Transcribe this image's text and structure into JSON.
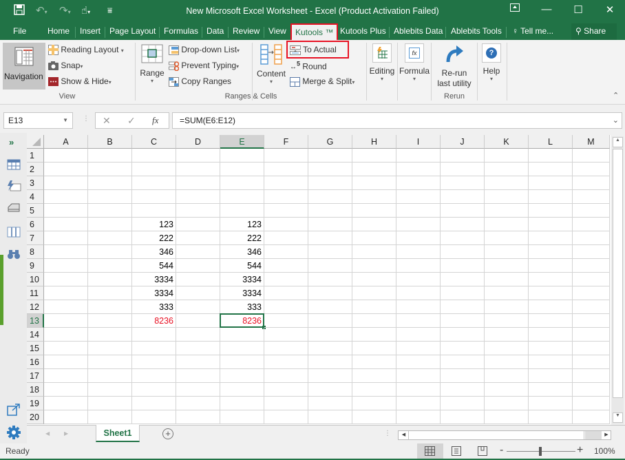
{
  "window": {
    "title": "New Microsoft Excel Worksheet - Excel (Product Activation Failed)",
    "controls": {
      "ribbon_display": "⊼",
      "minimize": "—",
      "maximize": "☐",
      "close": "✕"
    }
  },
  "quick_access": {
    "save": "save-icon",
    "undo": "undo-icon",
    "redo": "redo-icon",
    "touch": "touch-mode-icon",
    "customize": "customize-icon"
  },
  "ribbon_tabs": {
    "file": "File",
    "items": [
      "Home",
      "Insert",
      "Page Layout",
      "Formulas",
      "Data",
      "Review",
      "View",
      "Kutools ™",
      "Kutools Plus",
      "Ablebits Data",
      "Ablebits Tools"
    ],
    "active": "Kutools ™",
    "tell_me": "Tell me...",
    "share": "Share"
  },
  "ribbon": {
    "view_group": {
      "label": "View",
      "navigation": "Navigation",
      "reading_layout": "Reading Layout",
      "snap": "Snap",
      "show_hide": "Show & Hide"
    },
    "ranges_group": {
      "label": "Ranges & Cells",
      "range": "Range",
      "dropdown_list": "Drop-down List",
      "prevent_typing": "Prevent Typing",
      "copy_ranges": "Copy Ranges",
      "content": "Content",
      "to_actual": "To Actual",
      "round": "Round",
      "merge_split": "Merge & Split"
    },
    "editing": "Editing",
    "formula": "Formula",
    "rerun_group": {
      "label": "Rerun",
      "rerun_line1": "Re-run",
      "rerun_line2": "last utility"
    },
    "help": "Help"
  },
  "formula_bar": {
    "name_box": "E13",
    "cancel": "✕",
    "enter": "✓",
    "fx": "fx",
    "formula": "=SUM(E6:E12)"
  },
  "sheet": {
    "columns": [
      "A",
      "B",
      "C",
      "D",
      "E",
      "F",
      "G",
      "H",
      "I",
      "J",
      "K",
      "L",
      "M"
    ],
    "rows": [
      "1",
      "2",
      "3",
      "4",
      "5",
      "6",
      "7",
      "8",
      "9",
      "10",
      "11",
      "12",
      "13",
      "14",
      "15",
      "16",
      "17",
      "18",
      "19",
      "20"
    ],
    "selected_cell": "E13",
    "cells": {
      "C": {
        "6": "123",
        "7": "222",
        "8": "346",
        "9": "544",
        "10": "3334",
        "11": "3334",
        "12": "333",
        "13": "8236"
      },
      "E": {
        "6": "123",
        "7": "222",
        "8": "346",
        "9": "544",
        "10": "3334",
        "11": "3334",
        "12": "333",
        "13": "8236"
      }
    },
    "highlight_color": "#e81123",
    "accent_color": "#217346"
  },
  "sheet_tabs": {
    "tabs": [
      "Sheet1"
    ],
    "active": "Sheet1",
    "add": "+"
  },
  "status_bar": {
    "status": "Ready",
    "zoom": "100%"
  }
}
